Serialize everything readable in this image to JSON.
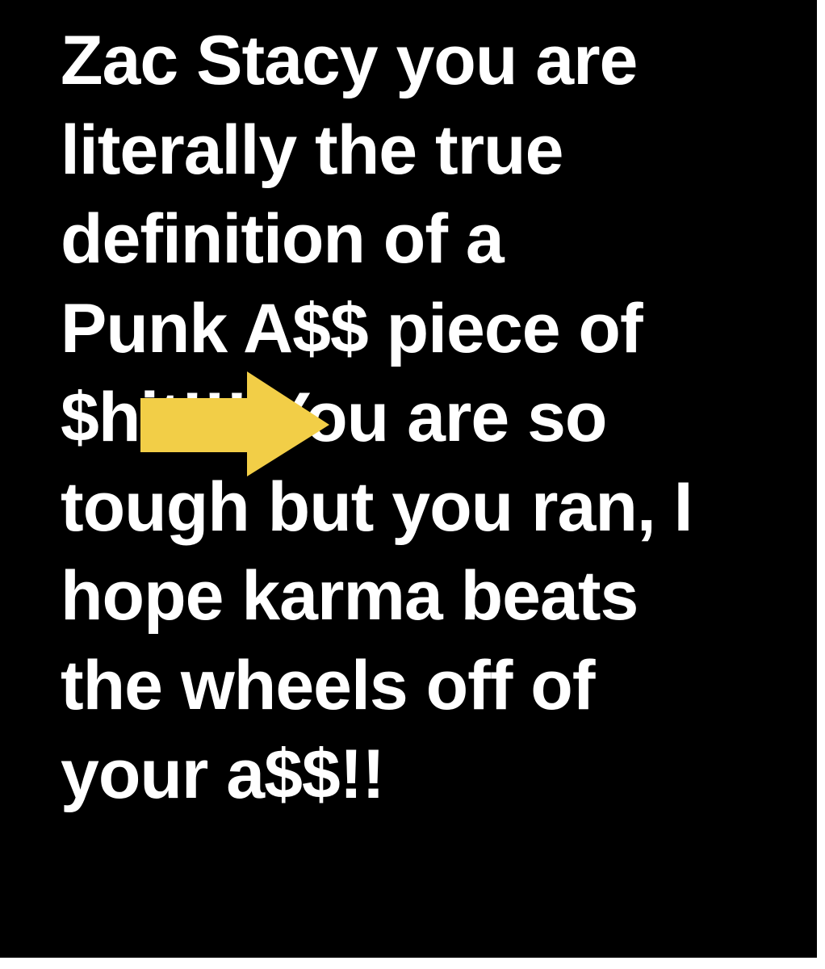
{
  "post": {
    "lines": [
      "Zac Stacy you are",
      "literally the true",
      "definition of a",
      "Punk A$$ piece of",
      "$hit!!! You are so",
      "tough but you ran, I",
      "hope karma beats",
      "the wheels off of",
      "your a$$!!"
    ]
  },
  "colors": {
    "background": "#000000",
    "text": "#ffffff",
    "arrow": "#f2ce47"
  },
  "overlay": {
    "icon": "right-arrow-icon"
  }
}
